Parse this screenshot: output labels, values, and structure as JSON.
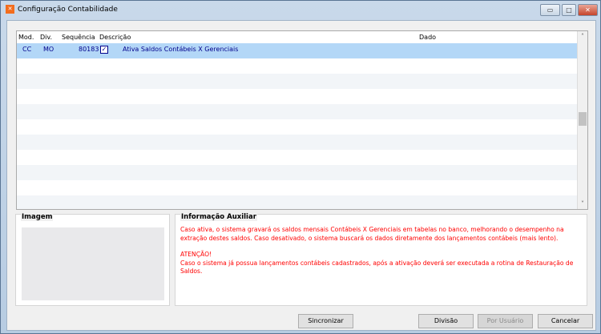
{
  "window": {
    "title": "Configuração Contabilidade",
    "minimize": "▭",
    "maximize": "□",
    "close": "✕"
  },
  "grid": {
    "columns": [
      "Mod.",
      "Div.",
      "Sequência",
      "Descrição",
      "Dado"
    ],
    "rows": [
      {
        "mod": "CC",
        "div": "MO",
        "seq": "80183",
        "checked": true,
        "desc": "Ativa Saldos Contábeis X Gerenciais",
        "dado": ""
      }
    ]
  },
  "image_panel": {
    "label": "Imagem"
  },
  "info_panel": {
    "label": "Informação Auxiliar",
    "line1": "Caso ativa, o sistema gravará os saldos mensais Contábeis X Gerenciais em tabelas no banco, melhorando o desempenho na extração destes saldos. Caso desativado, o sistema buscará os dados diretamente dos lançamentos contábeis (mais lento).",
    "line2": "ATENÇÃO!",
    "line3": "Caso o sistema já possua lançamentos contábeis cadastrados, após a ativação deverá ser executada a rotina de Restauração de Saldos."
  },
  "buttons": {
    "sync": "Sincronizar",
    "division": "Divisão",
    "by_user": "Por Usuário",
    "cancel": "Cancelar"
  }
}
